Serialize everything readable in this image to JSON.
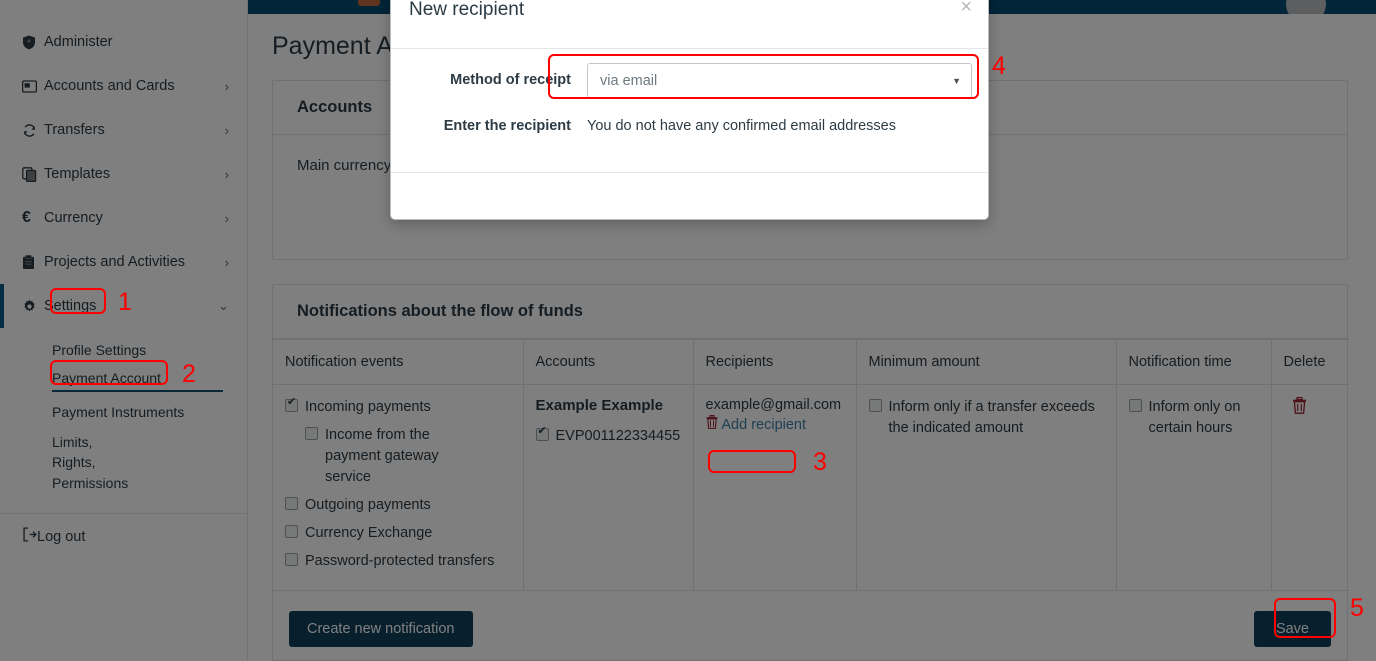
{
  "topbar": {
    "avatar_label": "user-avatar",
    "logo_label": "app-logo"
  },
  "sidebar": {
    "items": [
      {
        "label": "Administer",
        "icon": "shield-icon",
        "chevron": ""
      },
      {
        "label": "Accounts and Cards",
        "icon": "card-icon",
        "chevron": "›"
      },
      {
        "label": "Transfers",
        "icon": "refresh-icon",
        "chevron": "›"
      },
      {
        "label": "Templates",
        "icon": "copy-icon",
        "chevron": "›"
      },
      {
        "label": "Currency",
        "icon": "euro-icon",
        "chevron": "›"
      },
      {
        "label": "Projects and Activities",
        "icon": "clipboard-icon",
        "chevron": "›"
      },
      {
        "label": "Settings",
        "icon": "gear-icon",
        "chevron": "⌄"
      }
    ],
    "sub_items": [
      "Profile Settings",
      "Payment Account",
      "Payment Instruments",
      "Limits, Rights, Permissions"
    ],
    "logout": {
      "label": "Log out",
      "icon": "logout-icon"
    }
  },
  "page": {
    "title": "Payment Account"
  },
  "accounts_card": {
    "heading": "Accounts",
    "main_currency_label": "Main currency:"
  },
  "notifications_card": {
    "heading": "Notifications about the flow of funds",
    "columns": [
      "Notification events",
      "Accounts",
      "Recipients",
      "Minimum amount",
      "Notification time",
      "Delete"
    ],
    "row": {
      "events": [
        {
          "label": "Incoming payments",
          "checked": true,
          "indent": false
        },
        {
          "label": "Income from the payment gateway service",
          "checked": false,
          "indent": true
        },
        {
          "label": "Outgoing payments",
          "checked": false,
          "indent": false
        },
        {
          "label": "Currency Exchange",
          "checked": false,
          "indent": false
        },
        {
          "label": "Password-protected transfers",
          "checked": false,
          "indent": false
        }
      ],
      "account_name": "Example Example",
      "account_number": "EVP001122334455",
      "account_checked": true,
      "recipient_email": "example@gmail.com",
      "delete_recipient_icon": "trash-icon",
      "add_recipient_label": "Add recipient",
      "minimum_amount": {
        "label": "Inform only if a transfer exceeds the indicated amount",
        "checked": false
      },
      "notification_time": {
        "label": "Inform only on certain hours",
        "checked": false
      },
      "delete_row_icon": "trash-icon"
    },
    "create_button": "Create new notification",
    "save_button": "Save"
  },
  "modal": {
    "title": "New recipient",
    "close_icon": "×",
    "method_label": "Method of receipt",
    "method_value": "via email",
    "method_caret": "▼",
    "recipient_label": "Enter the recipient",
    "recipient_message": "You do not have any confirmed email addresses"
  },
  "annotations": [
    {
      "num": "1"
    },
    {
      "num": "2"
    },
    {
      "num": "3"
    },
    {
      "num": "4"
    },
    {
      "num": "5"
    }
  ],
  "colors": {
    "brand_dark": "#024a72",
    "button": "#11405c",
    "link": "#3f7fa6",
    "annotation": "#fe0000",
    "danger": "#9b2335"
  }
}
